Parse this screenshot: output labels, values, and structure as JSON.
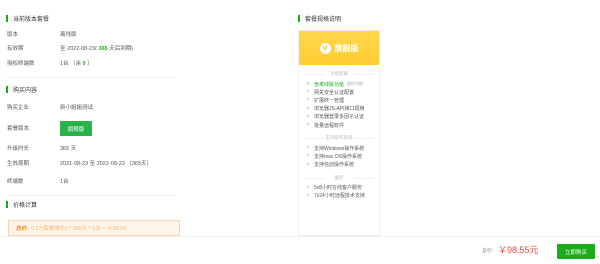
{
  "current_version": {
    "title": "当前版本套餐",
    "rows": [
      {
        "label": "版本",
        "value": "离线版"
      },
      {
        "label": "有效期",
        "prefix": "至 2022-08-23( ",
        "highlight": "365",
        "suffix": " 天后到期)"
      },
      {
        "label": "授权终端数",
        "prefix": "1台 （余 ",
        "highlight": "0",
        "suffix": " ）"
      }
    ]
  },
  "purchase": {
    "title": "购买内容",
    "company_label": "购买企业",
    "company_value": "新小姐姐测试",
    "plan_label": "套餐版本",
    "plan_button": "旗舰版",
    "duration_label": "升级时长",
    "duration_value": "365 天",
    "period_label": "生效周期",
    "period_value": "2021-08-23 至 2022-08-23 （365天）",
    "terminals_label": "终端数",
    "terminals_value": "1台"
  },
  "price_calc": {
    "title": "价格计算",
    "total_label": "总价:",
    "total_value": "0.27(套餐单价) * 365天 * 1台 = ￥98.55"
  },
  "plan_desc": {
    "title": "套餐规格说明",
    "card_title": "旗舰版",
    "badge": "V",
    "group1": "功能套餐",
    "features1": [
      {
        "text": "含离线版功能",
        "note": "提供功能",
        "hi": true
      },
      {
        "text": "网关安全认证配置",
        "hi": false
      },
      {
        "text": "扩展终一管理",
        "hi": false
      },
      {
        "text": "浏览器JS-API接口调用",
        "hi": false
      },
      {
        "text": "浏览器登录多因子认证",
        "hi": false
      },
      {
        "text": "批量远程软件",
        "hi": false
      }
    ],
    "group2": "支持操作系统",
    "features2": [
      {
        "text": "支持Windows操作系统"
      },
      {
        "text": "支持mac OS操作系统"
      },
      {
        "text": "支持信创操作系统"
      }
    ],
    "group3": "服务",
    "features3": [
      {
        "text": "5x8小时在线客户服务"
      },
      {
        "text": "7x24小时远程技术支持"
      }
    ]
  },
  "footer": {
    "total_label": "总价:",
    "total_price": "￥98.55元",
    "confirm_button": "立即购买"
  },
  "colors": {
    "accent": "#1aad19",
    "price": "#e94b3c",
    "gold": "#ffcc33"
  }
}
